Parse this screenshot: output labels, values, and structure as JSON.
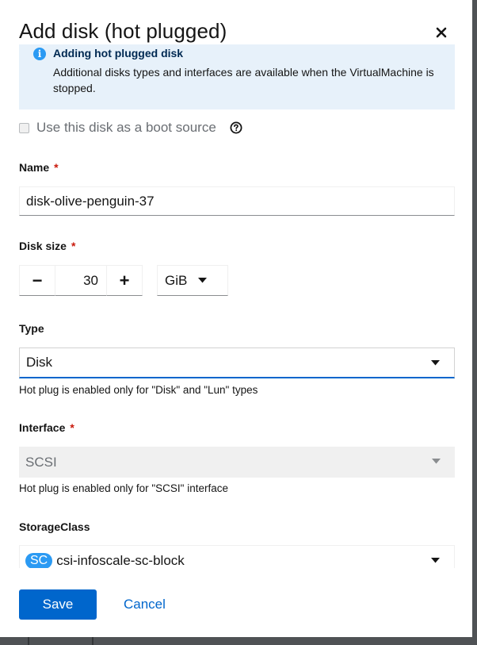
{
  "modal": {
    "title": "Add disk (hot plugged)"
  },
  "alert": {
    "title": "Adding hot plugged disk",
    "body": "Additional disks types and interfaces are available when the VirtualMachine is stopped."
  },
  "boot_source": {
    "label": "Use this disk as a boot source",
    "checked": false
  },
  "name": {
    "label": "Name",
    "required_mark": "*",
    "value": "disk-olive-penguin-37"
  },
  "disk_size": {
    "label": "Disk size",
    "required_mark": "*",
    "value": "30",
    "minus": "−",
    "plus": "+",
    "unit": "GiB"
  },
  "type": {
    "label": "Type",
    "value": "Disk",
    "helper": "Hot plug is enabled only for \"Disk\" and \"Lun\" types"
  },
  "interface": {
    "label": "Interface",
    "required_mark": "*",
    "value": "SCSI",
    "helper": "Hot plug is enabled only for \"SCSI\" interface"
  },
  "storage_class": {
    "label": "StorageClass",
    "badge": "SC",
    "value": "csi-infoscale-sc-block"
  },
  "footer": {
    "save_label": "Save",
    "cancel_label": "Cancel"
  },
  "colors": {
    "primary": "#0066cc",
    "info_bg": "#e7f1fa",
    "info_icon": "#2b9af3",
    "required": "#c9190b"
  }
}
